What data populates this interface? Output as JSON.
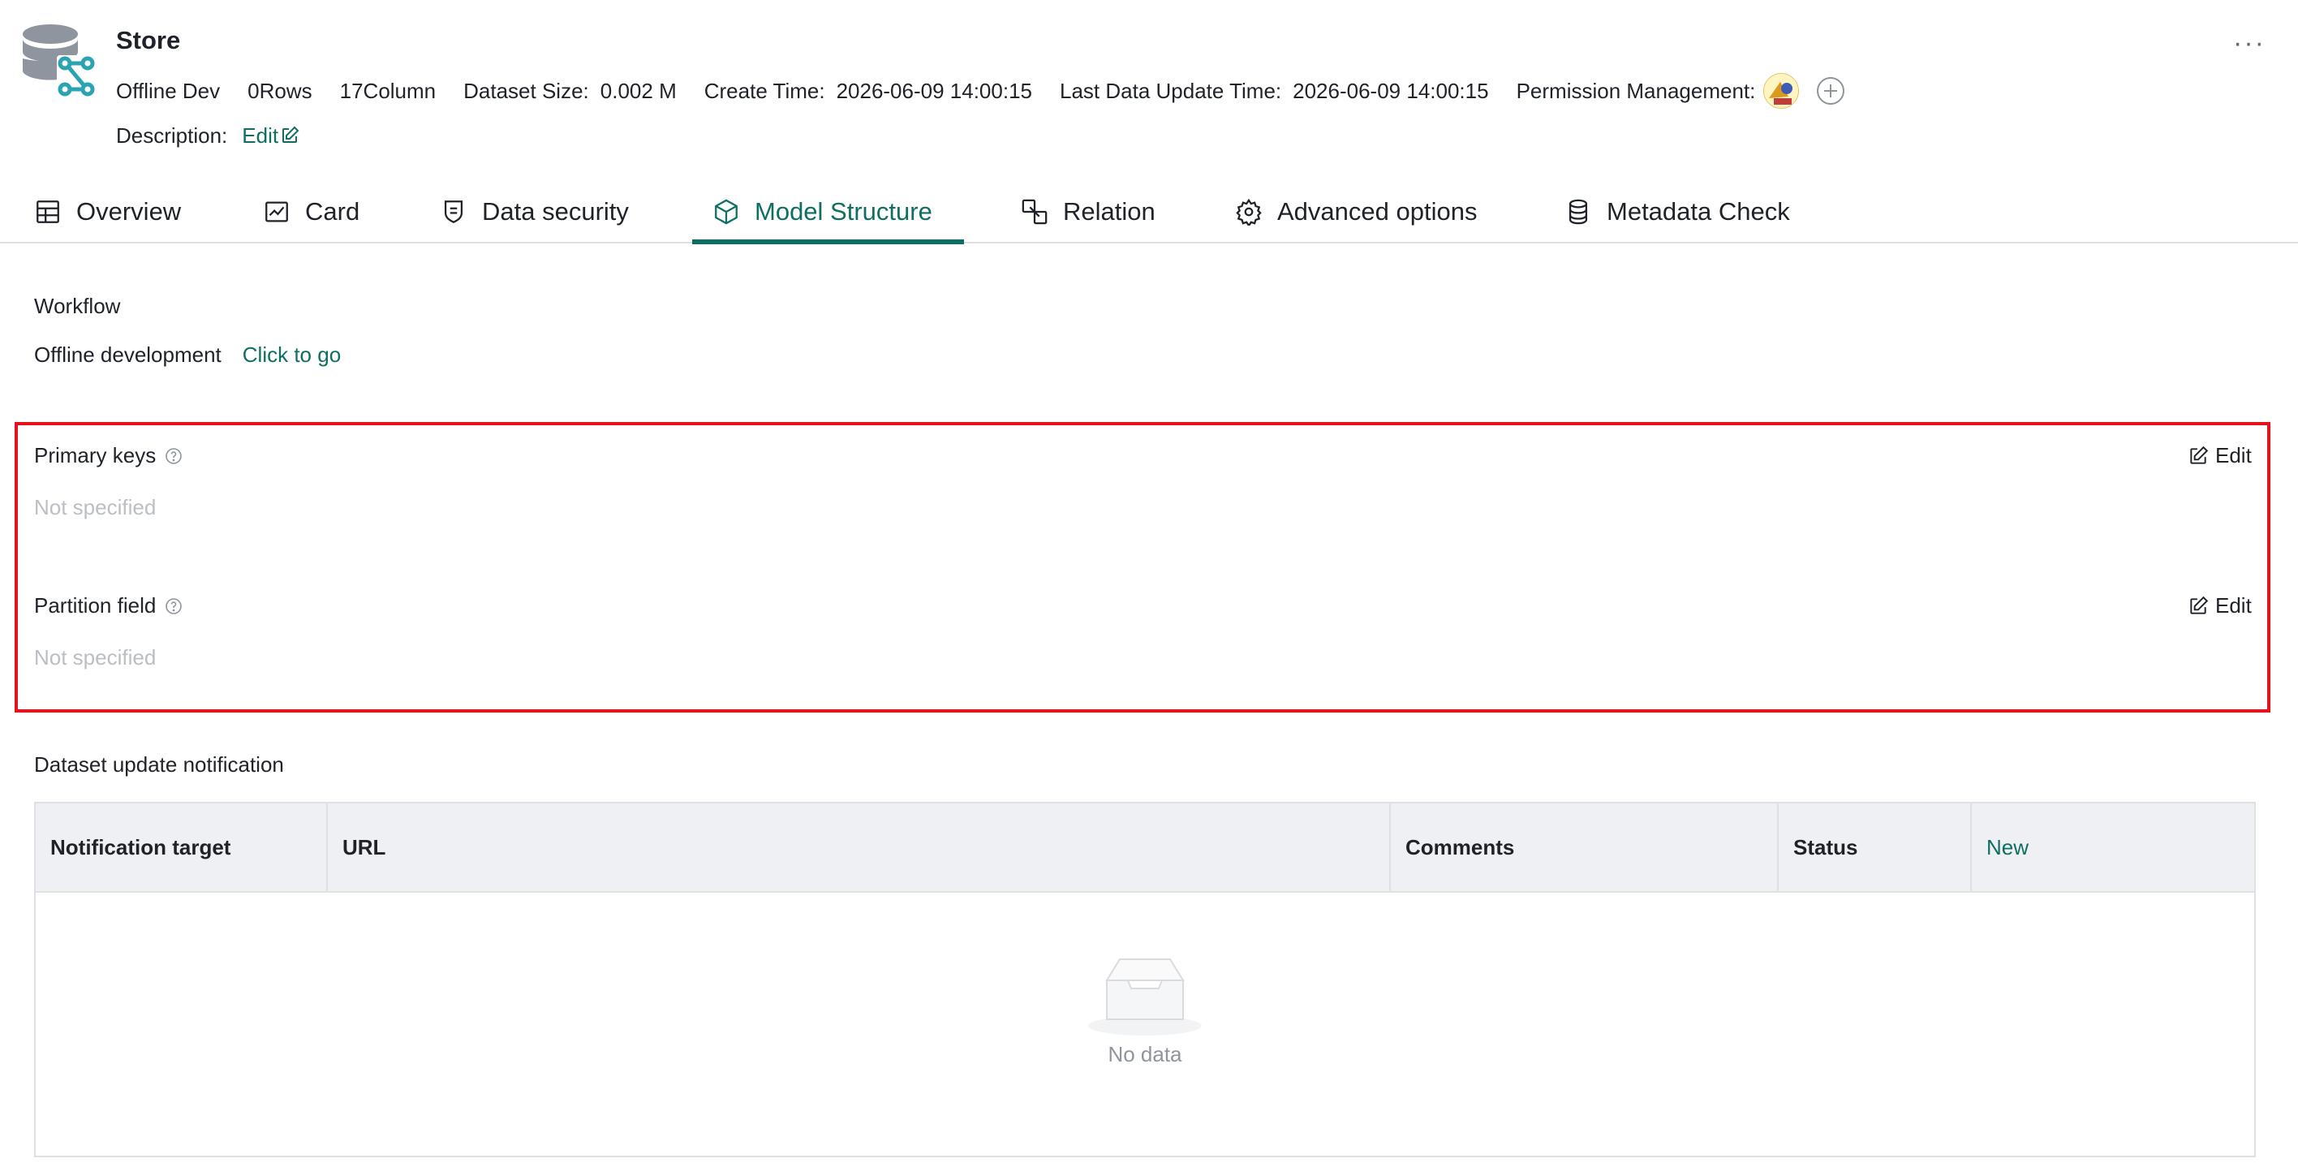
{
  "header": {
    "title": "Store",
    "source": "Offline Dev",
    "rows": "0Rows",
    "columns": "17Column",
    "dataset_size_label": "Dataset Size:",
    "dataset_size_value": "0.002 M",
    "create_time_label": "Create Time:",
    "create_time_value": "2026-06-09 14:00:15",
    "last_update_label": "Last Data Update Time:",
    "last_update_value": "2026-06-09 14:00:15",
    "permission_label": "Permission Management:",
    "description_label": "Description:",
    "description_edit": "Edit",
    "more_icon": "ellipsis-icon"
  },
  "tabs": [
    {
      "label": "Overview",
      "icon": "table-icon"
    },
    {
      "label": "Card",
      "icon": "chart-icon"
    },
    {
      "label": "Data security",
      "icon": "shield-icon"
    },
    {
      "label": "Model Structure",
      "icon": "cube-icon",
      "active": true
    },
    {
      "label": "Relation",
      "icon": "relation-icon"
    },
    {
      "label": "Advanced options",
      "icon": "gear-icon"
    },
    {
      "label": "Metadata Check",
      "icon": "database-icon"
    }
  ],
  "workflow": {
    "title": "Workflow",
    "label": "Offline development",
    "link": "Click to go"
  },
  "primary_keys": {
    "label": "Primary keys",
    "value": "Not specified",
    "edit": "Edit"
  },
  "partition_field": {
    "label": "Partition field",
    "value": "Not specified",
    "edit": "Edit"
  },
  "notification": {
    "title": "Dataset update notification",
    "columns": [
      "Notification target",
      "URL",
      "Comments",
      "Status"
    ],
    "new_label": "New",
    "empty_text": "No data"
  },
  "colors": {
    "accent": "#0f6e62",
    "highlight_border": "#e8101b",
    "placeholder": "#bbbfc4"
  }
}
